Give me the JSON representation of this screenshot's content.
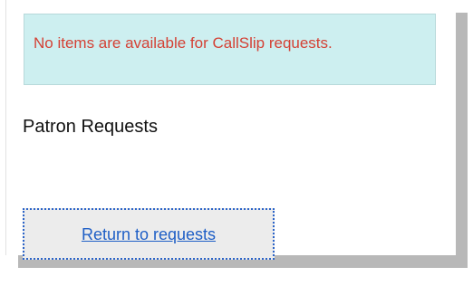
{
  "notice": {
    "message": "No items are available for CallSlip requests."
  },
  "page": {
    "heading": "Patron Requests"
  },
  "actions": {
    "return_label": "Return to requests"
  }
}
